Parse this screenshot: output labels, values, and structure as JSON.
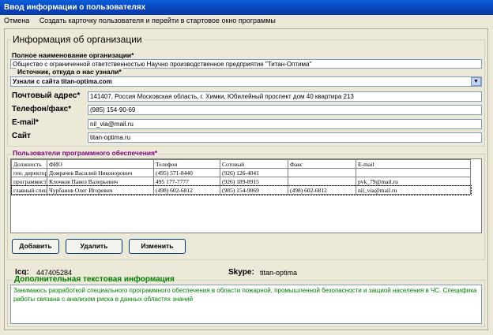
{
  "window": {
    "title": "Ввод информации о пользователях"
  },
  "menu": {
    "items": [
      "Отмена",
      "Создать карточку пользователя и перейти в стартовое окно программы"
    ]
  },
  "org": {
    "section_title": "Информация об организации",
    "full_name_label": "Полное наименование организации*",
    "full_name_value": "Общество с ограниченной ответственностью Научно производственное предприятие \"Титан-Оптима\"",
    "source_label": "Источник, откуда о нас узнали*",
    "source_value": "Узнали с сайта titan-optima.com",
    "address_label": "Почтовый адрес*",
    "address_value": "141407, Россия Московская область, г. Химки, Юбилейный проспект дом 40 квартира 213",
    "phone_label": "Телефон/факс*",
    "phone_value": "(985) 154-90-69",
    "email_label": "E-mail*",
    "email_value": "nil_via@mail.ru",
    "site_label": "Сайт",
    "site_value": "titan-optima.ru"
  },
  "users": {
    "section_title": "Пользователи программного обеспечения*",
    "columns": [
      "Должность",
      "ФИО",
      "Телефон",
      "Сотовый",
      "Факс",
      "E-mail"
    ],
    "rows": [
      [
        "ген. директор",
        "Домрачев Василий Никонорович",
        "(495) 571-8440",
        "(926) 126-4041",
        "",
        ""
      ],
      [
        "программист",
        "Клочков Павел Валерьевич",
        "495 177-7777",
        "(926) 189-8915",
        "",
        "pvk_79@mail.ru"
      ],
      [
        "главный специалист",
        "Чурбанов Олег Игоревич",
        "(498) 602-6812",
        "(985) 154-9069",
        "(498) 602-6812",
        "nil_via@mail.ru"
      ]
    ],
    "add_label": "Добавить",
    "delete_label": "Удалить",
    "edit_label": "Изменить"
  },
  "extra": {
    "icq_label": "Icq:",
    "icq_value": "447405284",
    "skype_label": "Skype:",
    "skype_value": "titan-optima",
    "section_title": "Дополнительная текстовая информация",
    "text": "Занимаюсь разработкой специального программного обеспечения в области пожарной, промышленной безопасности и защиой населения в ЧС. Специфика работы связана с анализом риска в данных областях знаний"
  },
  "colors": {
    "title_blue": "#0842b8",
    "purple": "#800080",
    "green": "#008000"
  },
  "icons": {
    "dropdown": "chevron-down-icon"
  }
}
